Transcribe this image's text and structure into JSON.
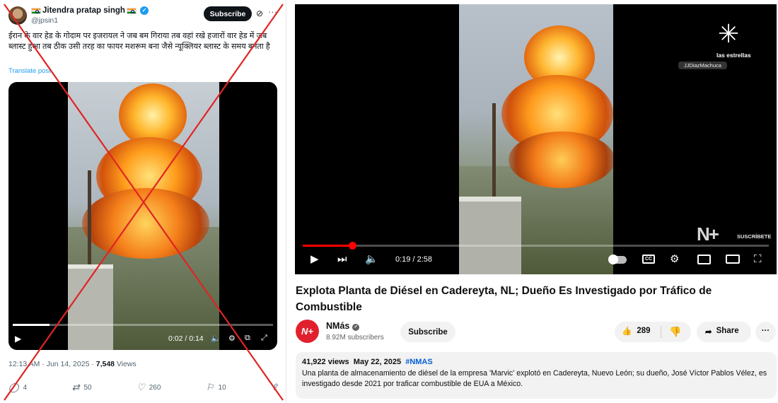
{
  "tweet": {
    "author_name": "Jitendra pratap singh",
    "author_handle": "@jpsin1",
    "subscribe_label": "Subscribe",
    "text": "ईरान के वार हेड के गोदाम पर इजरायल ने जब बम गिराया तब वहां रखे हजारों वार हेड में जब ब्लास्ट हुआ तब ठीक उसी तरह का फायर मशरूम बना जैसे न्यूक्लियर ब्लास्ट के समय बनता है",
    "translate_label": "Translate post",
    "video": {
      "time": "0:02 / 0:14",
      "progress": 0.14
    },
    "timestamp": "12:13 AM · Jun 14, 2025 · ",
    "views_count": "7,548",
    "views_label": " Views",
    "actions": {
      "replies": "4",
      "reposts": "50",
      "likes": "260",
      "bookmarks": "10"
    },
    "icons": [
      "verified-icon",
      "india-flag-icon",
      "grok-icon",
      "more-icon",
      "play-icon",
      "volume-icon",
      "settings-icon",
      "pip-icon",
      "fullscreen-icon",
      "reply-icon",
      "repost-icon",
      "like-icon",
      "bookmark-icon",
      "share-icon"
    ],
    "overlay_color": "#e02424"
  },
  "youtube": {
    "player": {
      "watermark": "las estrellas",
      "credit": "JJDiazMachuca",
      "corner_logo": "N+",
      "suscribete": "SUSCRÍBETE",
      "time": "0:19 / 2:58",
      "progress": 0.1067
    },
    "title": "Explota Planta de Diésel en Cadereyta, NL; Dueño Es Investigado por Tráfico de Combustible",
    "channel": {
      "name": "NMás",
      "subscribers": "8.92M subscribers",
      "avatar_text": "N+"
    },
    "subscribe_label": "Subscribe",
    "likes": "289",
    "share_label": "Share",
    "description": {
      "views": "41,922 views",
      "date": "May 22, 2025",
      "hashtag": "#NMAS",
      "text": "Una planta de almacenamiento de diésel de la empresa 'Marvic' explotó en Cadereyta, Nuevo León; su dueño, José Víctor Pablos Vélez, es investigado desde 2021 por traficar combustible de EUA a México."
    },
    "accent_color": "#ff0000"
  }
}
